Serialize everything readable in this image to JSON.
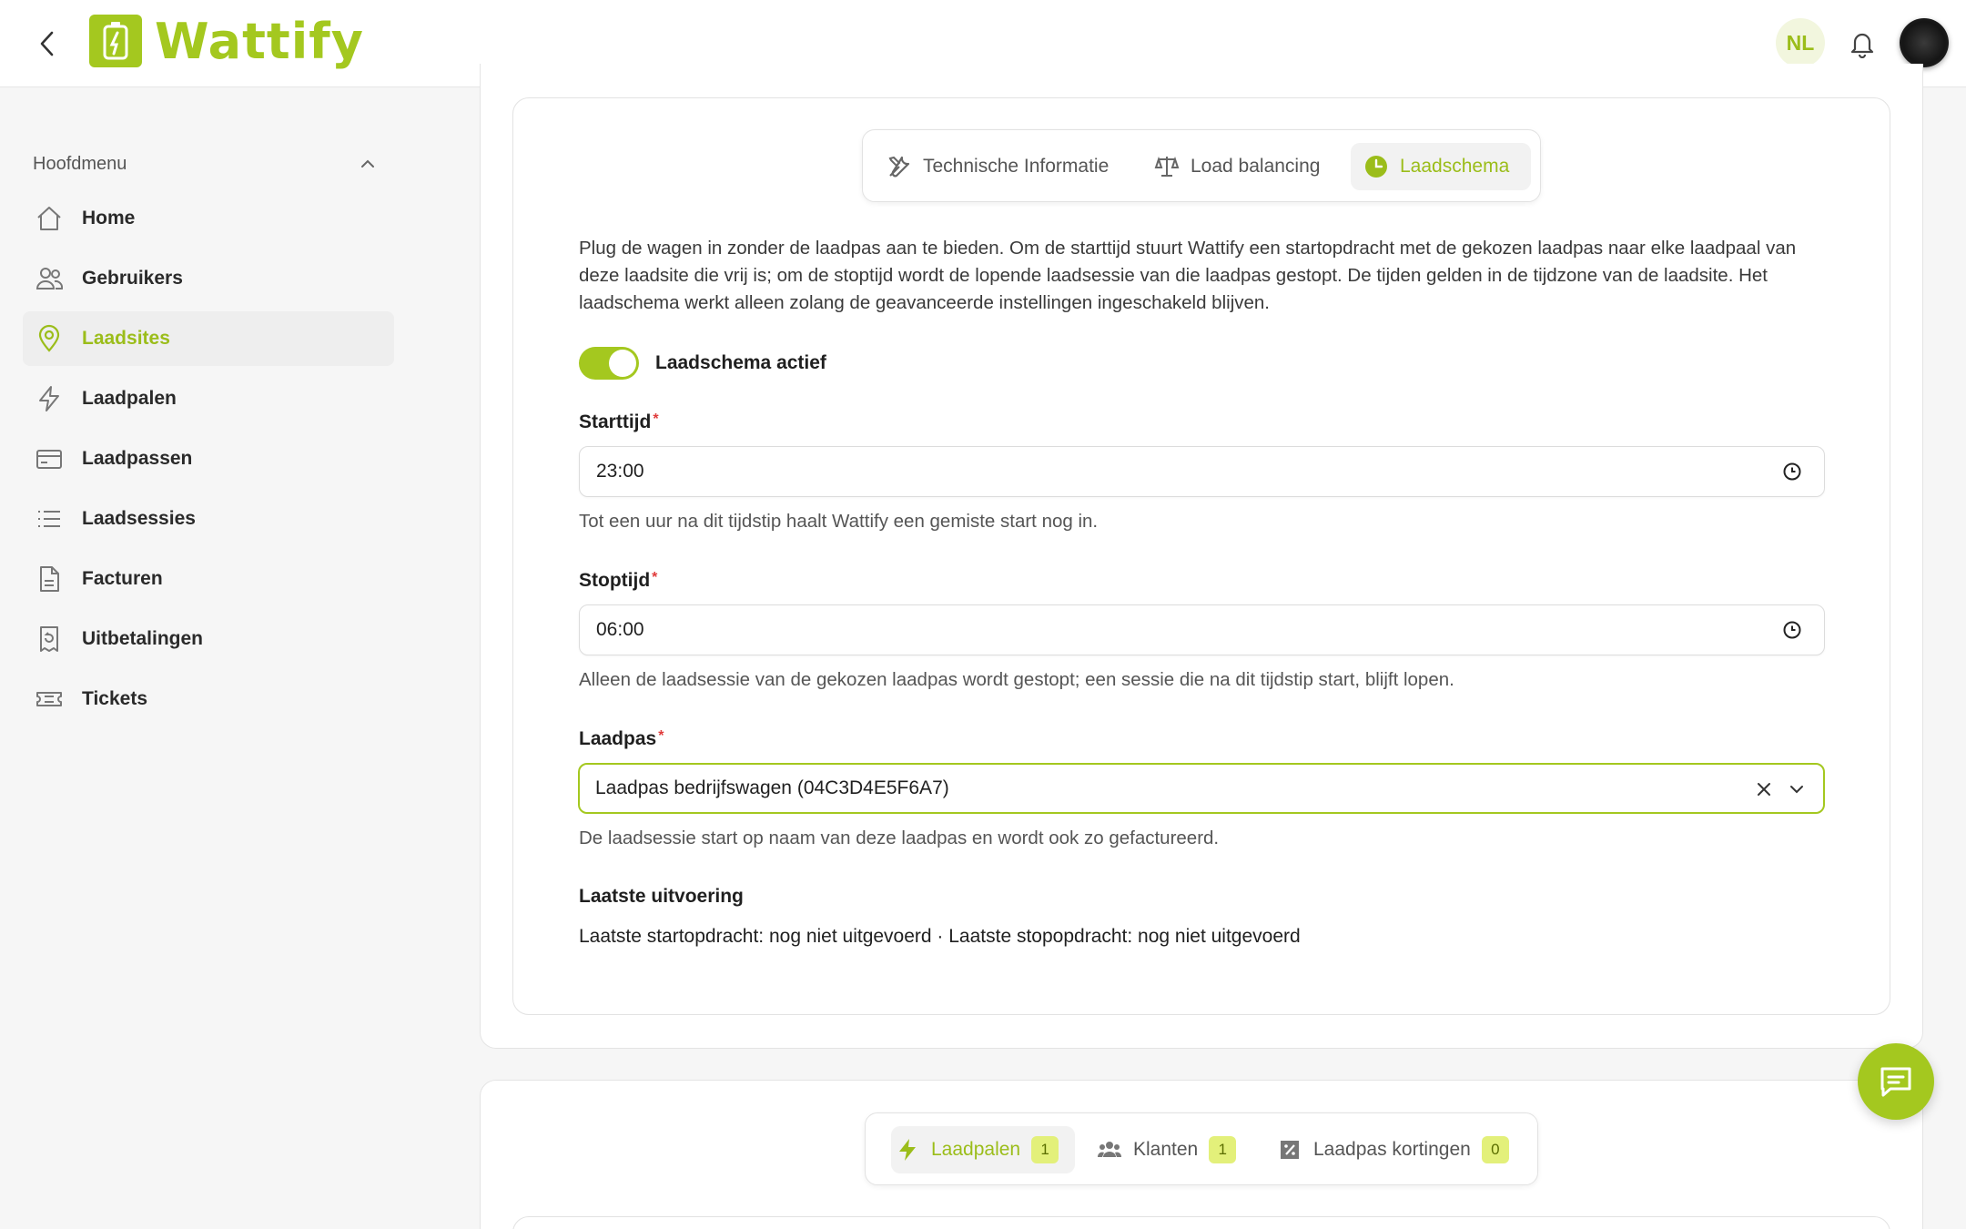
{
  "header": {
    "brand": "Wattify",
    "language": "NL"
  },
  "sidebar": {
    "section_title": "Hoofdmenu",
    "items": [
      {
        "label": "Home",
        "icon": "home-icon"
      },
      {
        "label": "Gebruikers",
        "icon": "users-icon"
      },
      {
        "label": "Laadsites",
        "icon": "map-pin-icon",
        "active": true
      },
      {
        "label": "Laadpalen",
        "icon": "lightning-icon"
      },
      {
        "label": "Laadpassen",
        "icon": "card-icon"
      },
      {
        "label": "Laadsessies",
        "icon": "list-icon"
      },
      {
        "label": "Facturen",
        "icon": "document-icon"
      },
      {
        "label": "Uitbetalingen",
        "icon": "receipt-icon"
      },
      {
        "label": "Tickets",
        "icon": "ticket-icon"
      }
    ]
  },
  "tabs": [
    {
      "label": "Technische Informatie",
      "icon": "tools-icon"
    },
    {
      "label": "Load balancing",
      "icon": "scale-icon"
    },
    {
      "label": "Laadschema",
      "icon": "clock-icon",
      "active": true
    }
  ],
  "schedule": {
    "description": "Plug de wagen in zonder de laadpas aan te bieden. Om de starttijd stuurt Wattify een startopdracht met de gekozen laadpas naar elke laadpaal van deze laadsite die vrij is; om de stoptijd wordt de lopende laadsessie van die laadpas gestopt. De tijden gelden in de tijdzone van de laadsite. Het laadschema werkt alleen zolang de geavanceerde instellingen ingeschakeld blijven.",
    "toggle_label": "Laadschema actief",
    "start": {
      "label": "Starttijd",
      "required": "*",
      "value": "23:00",
      "hint": "Tot een uur na dit tijdstip haalt Wattify een gemiste start nog in."
    },
    "stop": {
      "label": "Stoptijd",
      "required": "*",
      "value": "06:00",
      "hint": "Alleen de laadsessie van de gekozen laadpas wordt gestopt; een sessie die na dit tijdstip start, blijft lopen."
    },
    "card": {
      "label": "Laadpas",
      "required": "*",
      "value": "Laadpas bedrijfswagen (04C3D4E5F6A7)",
      "hint": "De laadsessie start op naam van deze laadpas en wordt ook zo gefactureerd."
    },
    "last_run": {
      "title": "Laatste uitvoering",
      "text": "Laatste startopdracht: nog niet uitgevoerd · Laatste stopopdracht: nog niet uitgevoerd"
    }
  },
  "tabs2": [
    {
      "label": "Laadpalen",
      "count": "1",
      "icon": "lightning-icon",
      "active": true
    },
    {
      "label": "Klanten",
      "count": "1",
      "icon": "group-icon"
    },
    {
      "label": "Laadpas kortingen",
      "count": "0",
      "icon": "discount-icon"
    }
  ],
  "colors": {
    "accent": "#a4c81f",
    "accent_text": "#9bbd1a",
    "required": "#e03b3b"
  }
}
